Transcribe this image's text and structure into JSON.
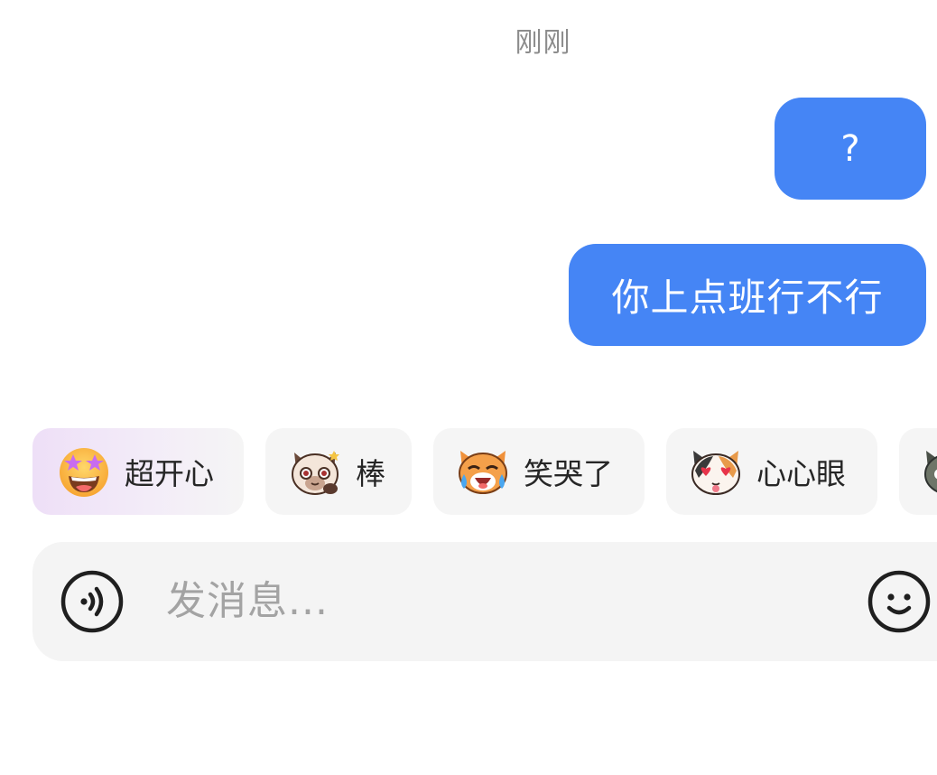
{
  "chat": {
    "timestamp": "刚刚",
    "messages": [
      {
        "text": "?",
        "sender": "me"
      },
      {
        "text": "你上点班行不行",
        "sender": "me"
      }
    ],
    "bubble_color": "#4585f5"
  },
  "sticker_suggestions": [
    {
      "label": "超开心",
      "icon": "star-eyes-smile-icon",
      "highlighted": true
    },
    {
      "label": "棒",
      "icon": "siamese-cat-thumbs-up-icon",
      "highlighted": false
    },
    {
      "label": "笑哭了",
      "icon": "orange-cat-tears-of-joy-icon",
      "highlighted": false
    },
    {
      "label": "心心眼",
      "icon": "calico-cat-heart-eyes-icon",
      "highlighted": false
    },
    {
      "label": "",
      "icon": "gray-cat-icon",
      "highlighted": false
    }
  ],
  "composer": {
    "placeholder": "发消息...",
    "voice_icon": "voice-input-icon",
    "emoji_icon": "emoji-face-icon"
  }
}
